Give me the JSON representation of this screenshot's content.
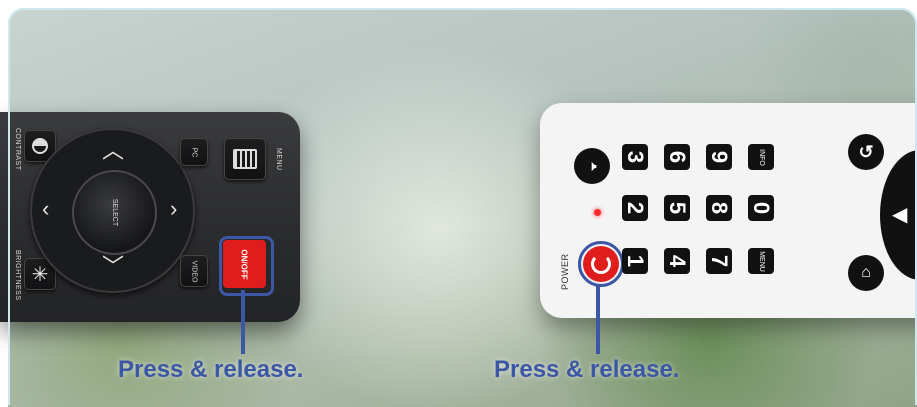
{
  "left_remote": {
    "contrast_label": "CONTRAST",
    "brightness_label": "BRIGHTNESS",
    "pc_label": "PC",
    "menu_label": "MENU",
    "select_label": "SELECT",
    "video_label": "VIDEO",
    "onoff_label": "ON/OFF"
  },
  "right_remote": {
    "power_label": "POWER",
    "info_label": "INFO",
    "menu_label": "MENU",
    "keys": [
      "3",
      "6",
      "9",
      "2",
      "5",
      "8",
      "0",
      "1",
      "4",
      "7"
    ]
  },
  "captions": {
    "left": "Press & release.",
    "right": "Press & release."
  },
  "colors": {
    "highlight": "#3b57a5",
    "power_red": "#e01d1d"
  }
}
